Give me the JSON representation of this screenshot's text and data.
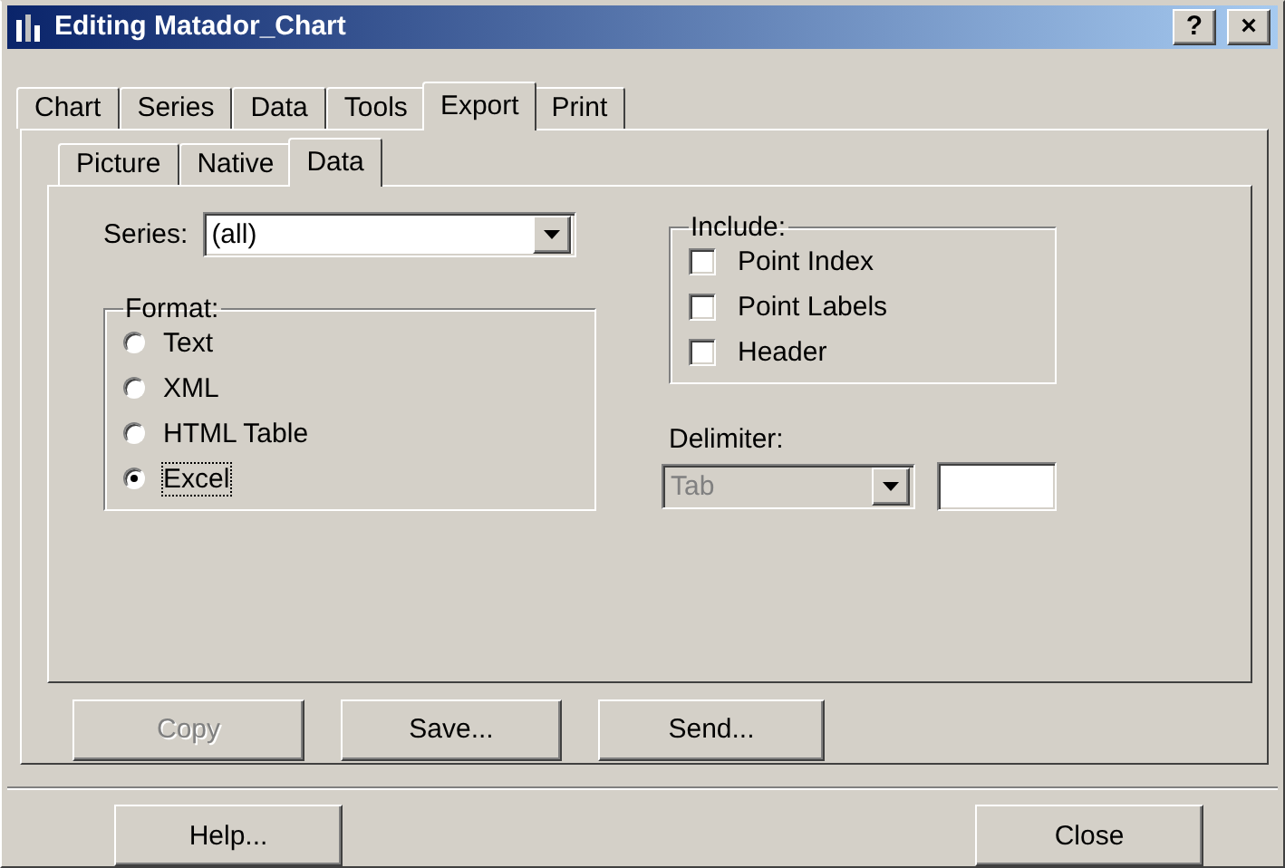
{
  "window": {
    "title": "Editing Matador_Chart",
    "title_buttons": [
      "?",
      "×"
    ]
  },
  "tabs": [
    {
      "label": "Chart",
      "selected": false
    },
    {
      "label": "Series",
      "selected": false
    },
    {
      "label": "Data",
      "selected": false
    },
    {
      "label": "Tools",
      "selected": false
    },
    {
      "label": "Export",
      "selected": true
    },
    {
      "label": "Print",
      "selected": false
    }
  ],
  "subtabs": [
    {
      "label": "Picture",
      "selected": false
    },
    {
      "label": "Native",
      "selected": false
    },
    {
      "label": "Data",
      "selected": true
    }
  ],
  "series": {
    "label": "Series:",
    "value": "(all)"
  },
  "format": {
    "title": "Format:",
    "options": [
      {
        "label": "Text",
        "selected": false,
        "focused": false
      },
      {
        "label": "XML",
        "selected": false,
        "focused": false
      },
      {
        "label": "HTML Table",
        "selected": false,
        "focused": false
      },
      {
        "label": "Excel",
        "selected": true,
        "focused": true
      }
    ]
  },
  "include": {
    "title": "Include:",
    "options": [
      {
        "label": "Point Index",
        "checked": false
      },
      {
        "label": "Point Labels",
        "checked": false
      },
      {
        "label": "Header",
        "checked": false
      }
    ]
  },
  "delimiter": {
    "label": "Delimiter:",
    "value": "Tab",
    "disabled": true
  },
  "actions": [
    {
      "label": "Copy",
      "disabled": true
    },
    {
      "label": "Save...",
      "disabled": false
    },
    {
      "label": "Send...",
      "disabled": false
    }
  ],
  "footer": [
    {
      "label": "Help..."
    },
    {
      "label": "Close"
    }
  ]
}
